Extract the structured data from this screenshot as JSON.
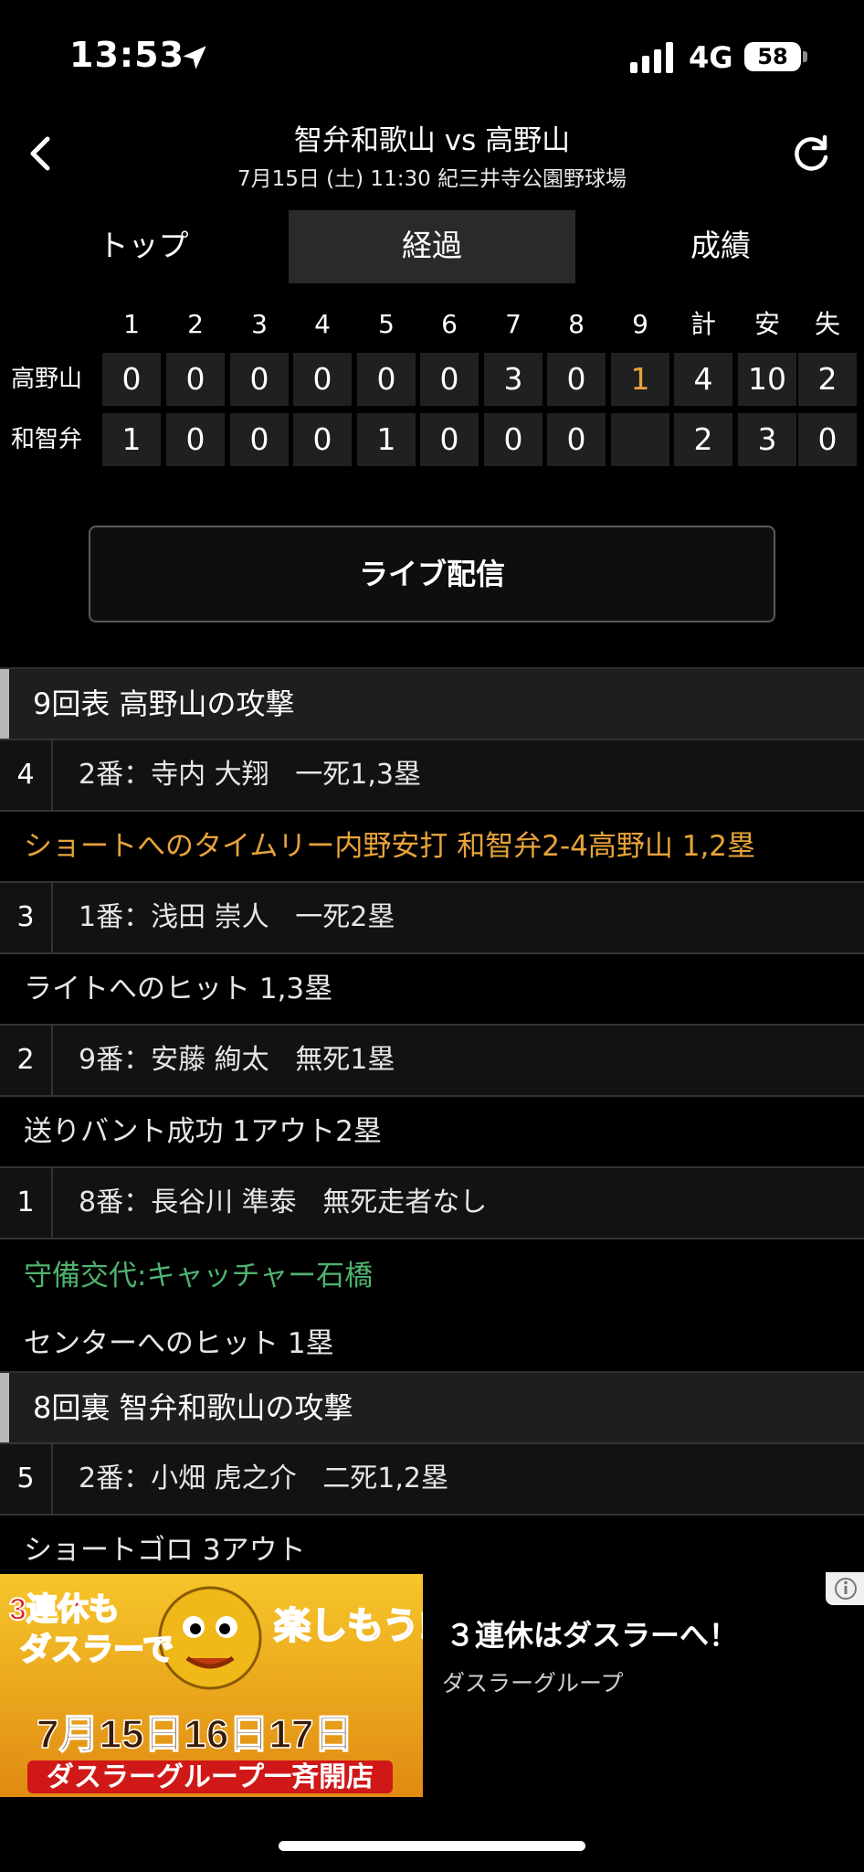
{
  "status_bar": {
    "time": "13:53",
    "network": "4G",
    "battery": "58"
  },
  "header": {
    "title": "智弁和歌山 vs 高野山",
    "subtitle": "7月15日 (土) 11:30 紀三井寺公園野球場"
  },
  "tabs": [
    {
      "label": "トップ",
      "active": false
    },
    {
      "label": "経過",
      "active": true
    },
    {
      "label": "成績",
      "active": false
    }
  ],
  "scoreboard": {
    "columns": [
      "1",
      "2",
      "3",
      "4",
      "5",
      "6",
      "7",
      "8",
      "9",
      "計",
      "安",
      "失"
    ],
    "teams": [
      {
        "name": "高野山",
        "scores": [
          "0",
          "0",
          "0",
          "0",
          "0",
          "0",
          "3",
          "0",
          "1",
          "4",
          "10",
          "2"
        ]
      },
      {
        "name": "和智弁",
        "scores": [
          "1",
          "0",
          "0",
          "0",
          "1",
          "0",
          "0",
          "0",
          "",
          "2",
          "3",
          "0"
        ]
      }
    ],
    "highlight_color": "#e8a33a"
  },
  "live_button": {
    "label": "ライブ配信"
  },
  "plays": {
    "inning1": {
      "title": "9回表 高野山の攻撃"
    },
    "b4": {
      "num": "4",
      "info": "2番：寺内 大翔   一死1,3塁"
    },
    "e4": {
      "text": "ショートへのタイムリー内野安打 和智弁2-4高野山 1,2塁"
    },
    "b3": {
      "num": "3",
      "info": "1番：浅田 崇人   一死2塁"
    },
    "e3": {
      "text": "ライトへのヒット 1,3塁"
    },
    "b2": {
      "num": "2",
      "info": "9番：安藤 絢太   無死1塁"
    },
    "e2": {
      "text": "送りバント成功 1アウト2塁"
    },
    "b1": {
      "num": "1",
      "info": "8番：長谷川 準泰   無死走者なし"
    },
    "e1a": {
      "text": "守備交代:キャッチャー石橋"
    },
    "e1b": {
      "text": "センターへのヒット 1塁"
    },
    "inning2": {
      "title": "8回裏 智弁和歌山の攻撃"
    },
    "b5": {
      "num": "5",
      "info": "2番：小畑 虎之介   二死1,2塁"
    },
    "e5": {
      "text": "ショートゴロ 3アウト"
    }
  },
  "ad": {
    "title": "３連休はダスラーへ！",
    "sponsor": "ダスラーグループ",
    "banner": {
      "line1": "3連休も",
      "line2": "ダスラーで",
      "line3": "楽しもう!",
      "dates": "7月15日16日17日",
      "footer": "ダスラーグループ一斉開店"
    }
  }
}
